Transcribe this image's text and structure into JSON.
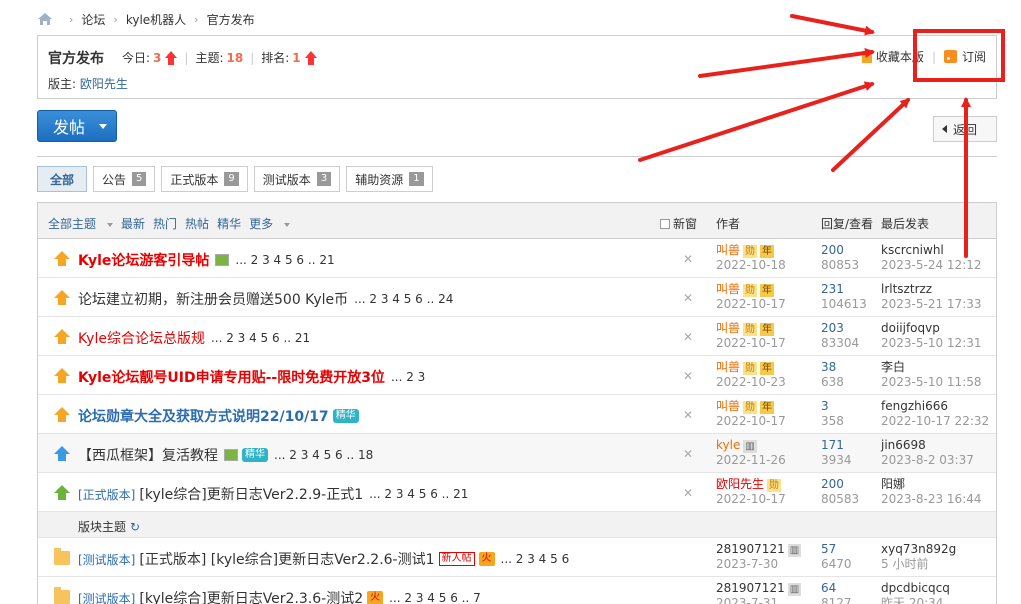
{
  "breadcrumb": [
    "论坛",
    "kyle机器人",
    "官方发布"
  ],
  "forum": {
    "name": "官方发布",
    "today_label": "今日:",
    "today_value": "3",
    "topics_label": "主题:",
    "topics_value": "18",
    "rank_label": "排名:",
    "rank_value": "1",
    "moderator_label": "版主:",
    "moderator_name": "欧阳先生",
    "favorite_label": "收藏本版",
    "subscribe_label": "订阅"
  },
  "post_button": "发帖",
  "back_button": "返回",
  "tabs": [
    {
      "label": "全部",
      "count": ""
    },
    {
      "label": "公告",
      "count": "5"
    },
    {
      "label": "正式版本",
      "count": "9"
    },
    {
      "label": "测试版本",
      "count": "3"
    },
    {
      "label": "辅助资源",
      "count": "1"
    }
  ],
  "list_header": {
    "all_topics": "全部主题",
    "latest": "最新",
    "hot": "热门",
    "hot_posts": "热帖",
    "digest": "精华",
    "more": "更多",
    "new_window": "新窗",
    "author": "作者",
    "replies_views": "回复/查看",
    "last_post": "最后发表"
  },
  "threads": [
    {
      "title": "Kyle论坛游客引导帖",
      "style": "t-red",
      "pages": "... 2 3 4 5 6 .. 21",
      "author": "叫兽",
      "date": "2022-10-18",
      "replies": "200",
      "views": "80853",
      "last_user": "kscrcniwhl",
      "last_date": "2023-5-24 12:12"
    },
    {
      "title": "论坛建立初期，新注册会员赠送500 Kyle币",
      "style": "t-norm",
      "pages": "... 2 3 4 5 6 .. 24",
      "author": "叫兽",
      "date": "2022-10-17",
      "replies": "231",
      "views": "104613",
      "last_user": "lrltsztrzz",
      "last_date": "2023-5-21 17:33"
    },
    {
      "title": "Kyle综合论坛总版规",
      "style": "t-red-n",
      "pages": "... 2 3 4 5 6 .. 21",
      "author": "叫兽",
      "date": "2022-10-17",
      "replies": "203",
      "views": "83304",
      "last_user": "doiijfoqvp",
      "last_date": "2023-5-10 12:31"
    },
    {
      "title": "Kyle论坛靓号UID申请专用贴--限时免费开放3位",
      "style": "t-red",
      "pages": "... 2 3",
      "author": "叫兽",
      "date": "2022-10-23",
      "replies": "38",
      "views": "638",
      "last_user": "李白",
      "last_date": "2023-5-10 11:58"
    },
    {
      "title": "论坛勋章大全及获取方式说明22/10/17",
      "style": "t-blue",
      "pages": "",
      "author": "叫兽",
      "date": "2022-10-17",
      "replies": "3",
      "views": "358",
      "last_user": "fengzhi666",
      "last_date": "2022-10-17 22:32"
    },
    {
      "title": "【西瓜框架】复活教程",
      "style": "t-norm",
      "pages": "... 2 3 4 5 6 .. 18",
      "author": "kyle",
      "date": "2022-11-26",
      "replies": "171",
      "views": "3934",
      "last_user": "jin6698",
      "last_date": "2023-8-2 03:37"
    },
    {
      "type": "[正式版本]",
      "title": "[kyle综合]更新日志Ver2.2.9-正式1",
      "style": "t-norm",
      "pages": "... 2 3 4 5 6 .. 21",
      "author": "欧阳先生",
      "date": "2022-10-17",
      "replies": "200",
      "views": "80583",
      "last_user": "阳娜",
      "last_date": "2023-8-23 16:44"
    }
  ],
  "section_label": "版块主题",
  "normal_threads": [
    {
      "type": "[测试版本]",
      "title": "[正式版本] [kyle综合]更新日志Ver2.2.6-测试1",
      "badge_new": "新人帖",
      "badge_fire": "火",
      "pages": "... 2 3 4 5 6",
      "author": "281907121",
      "date": "2023-7-30",
      "replies": "57",
      "views": "6470",
      "last_user": "xyq73n892g",
      "last_date": "5 小时前"
    },
    {
      "type": "[测试版本]",
      "title": "[kyle综合]更新日志Ver2.3.6-测试2",
      "badge_fire": "火",
      "pages": "... 2 3 4 5 6 .. 7",
      "author": "281907121",
      "date": "2023-7-31",
      "replies": "64",
      "views": "8127",
      "last_user": "dpcdbicqcq",
      "last_date": "昨天 20:34"
    }
  ],
  "medals": {
    "m1": "勋",
    "m2": "年",
    "digest_badge": "精华"
  },
  "colors": {
    "accent_red": "#e8211c",
    "link_blue": "#336699",
    "button_blue": "#1d6fbf",
    "orange": "#f26c00"
  }
}
